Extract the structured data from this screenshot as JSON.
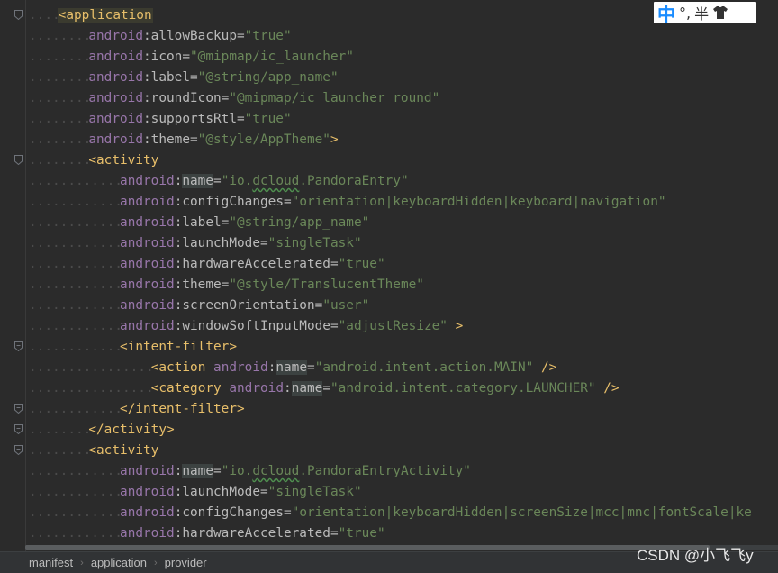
{
  "editor": {
    "language": "xml",
    "file": "manifest",
    "lines": [
      {
        "indent": 1,
        "tokens": [
          {
            "t": "hl-tag",
            "v": "<application"
          }
        ]
      },
      {
        "indent": 2,
        "tokens": [
          {
            "t": "ns",
            "v": "android"
          },
          {
            "t": "attr",
            "v": ":allowBackup="
          },
          {
            "t": "val",
            "v": "\"true\""
          }
        ]
      },
      {
        "indent": 2,
        "tokens": [
          {
            "t": "ns",
            "v": "android"
          },
          {
            "t": "attr",
            "v": ":icon="
          },
          {
            "t": "val",
            "v": "\"@mipmap/ic_launcher\""
          }
        ]
      },
      {
        "indent": 2,
        "tokens": [
          {
            "t": "ns",
            "v": "android"
          },
          {
            "t": "attr",
            "v": ":label="
          },
          {
            "t": "val",
            "v": "\"@string/app_name\""
          }
        ]
      },
      {
        "indent": 2,
        "tokens": [
          {
            "t": "ns",
            "v": "android"
          },
          {
            "t": "attr",
            "v": ":roundIcon="
          },
          {
            "t": "val",
            "v": "\"@mipmap/ic_launcher_round\""
          }
        ]
      },
      {
        "indent": 2,
        "tokens": [
          {
            "t": "ns",
            "v": "android"
          },
          {
            "t": "attr",
            "v": ":supportsRtl="
          },
          {
            "t": "val",
            "v": "\"true\""
          }
        ]
      },
      {
        "indent": 2,
        "tokens": [
          {
            "t": "ns",
            "v": "android"
          },
          {
            "t": "attr",
            "v": ":theme="
          },
          {
            "t": "val",
            "v": "\"@style/AppTheme\""
          },
          {
            "t": "tag",
            "v": ">"
          }
        ]
      },
      {
        "indent": 2,
        "tokens": [
          {
            "t": "tag",
            "v": "<activity"
          }
        ]
      },
      {
        "indent": 3,
        "tokens": [
          {
            "t": "ns",
            "v": "android"
          },
          {
            "t": "attr",
            "v": ":"
          },
          {
            "t": "attr hl-name",
            "v": "name"
          },
          {
            "t": "attr",
            "v": "="
          },
          {
            "t": "val",
            "v": "\"io."
          },
          {
            "t": "val wavy",
            "v": "dcloud"
          },
          {
            "t": "val",
            "v": ".PandoraEntry\""
          }
        ]
      },
      {
        "indent": 3,
        "tokens": [
          {
            "t": "ns",
            "v": "android"
          },
          {
            "t": "attr",
            "v": ":configChanges="
          },
          {
            "t": "val",
            "v": "\"orientation|keyboardHidden|keyboard|navigation\""
          }
        ]
      },
      {
        "indent": 3,
        "tokens": [
          {
            "t": "ns",
            "v": "android"
          },
          {
            "t": "attr",
            "v": ":label="
          },
          {
            "t": "val",
            "v": "\"@string/app_name\""
          }
        ]
      },
      {
        "indent": 3,
        "tokens": [
          {
            "t": "ns",
            "v": "android"
          },
          {
            "t": "attr",
            "v": ":launchMode="
          },
          {
            "t": "val",
            "v": "\"singleTask\""
          }
        ]
      },
      {
        "indent": 3,
        "tokens": [
          {
            "t": "ns",
            "v": "android"
          },
          {
            "t": "attr",
            "v": ":hardwareAccelerated="
          },
          {
            "t": "val",
            "v": "\"true\""
          }
        ]
      },
      {
        "indent": 3,
        "tokens": [
          {
            "t": "ns",
            "v": "android"
          },
          {
            "t": "attr",
            "v": ":theme="
          },
          {
            "t": "val",
            "v": "\"@style/TranslucentTheme\""
          }
        ]
      },
      {
        "indent": 3,
        "tokens": [
          {
            "t": "ns",
            "v": "android"
          },
          {
            "t": "attr",
            "v": ":screenOrientation="
          },
          {
            "t": "val",
            "v": "\"user\""
          }
        ]
      },
      {
        "indent": 3,
        "tokens": [
          {
            "t": "ns",
            "v": "android"
          },
          {
            "t": "attr",
            "v": ":windowSoftInputMode="
          },
          {
            "t": "val",
            "v": "\"adjustResize\""
          },
          {
            "t": "tag",
            "v": " >"
          }
        ]
      },
      {
        "indent": 3,
        "tokens": [
          {
            "t": "tag",
            "v": "<intent-filter>"
          }
        ]
      },
      {
        "indent": 4,
        "tokens": [
          {
            "t": "tag",
            "v": "<action "
          },
          {
            "t": "ns",
            "v": "android"
          },
          {
            "t": "attr",
            "v": ":"
          },
          {
            "t": "attr hl-name",
            "v": "name"
          },
          {
            "t": "attr",
            "v": "="
          },
          {
            "t": "val",
            "v": "\"android.intent.action.MAIN\""
          },
          {
            "t": "tag",
            "v": " />"
          }
        ]
      },
      {
        "indent": 4,
        "tokens": [
          {
            "t": "tag",
            "v": "<category "
          },
          {
            "t": "ns",
            "v": "android"
          },
          {
            "t": "attr",
            "v": ":"
          },
          {
            "t": "attr hl-name",
            "v": "name"
          },
          {
            "t": "attr",
            "v": "="
          },
          {
            "t": "val",
            "v": "\"android.intent.category.LAUNCHER\""
          },
          {
            "t": "tag",
            "v": " />"
          }
        ]
      },
      {
        "indent": 3,
        "tokens": [
          {
            "t": "tag",
            "v": "</intent-filter>"
          }
        ]
      },
      {
        "indent": 2,
        "tokens": [
          {
            "t": "tag",
            "v": "</activity>"
          }
        ]
      },
      {
        "indent": 2,
        "tokens": [
          {
            "t": "tag",
            "v": "<activity"
          }
        ]
      },
      {
        "indent": 3,
        "tokens": [
          {
            "t": "ns",
            "v": "android"
          },
          {
            "t": "attr",
            "v": ":"
          },
          {
            "t": "attr hl-name",
            "v": "name"
          },
          {
            "t": "attr",
            "v": "="
          },
          {
            "t": "val",
            "v": "\"io."
          },
          {
            "t": "val wavy",
            "v": "dcloud"
          },
          {
            "t": "val",
            "v": ".PandoraEntryActivity\""
          }
        ]
      },
      {
        "indent": 3,
        "tokens": [
          {
            "t": "ns",
            "v": "android"
          },
          {
            "t": "attr",
            "v": ":launchMode="
          },
          {
            "t": "val",
            "v": "\"singleTask\""
          }
        ]
      },
      {
        "indent": 3,
        "tokens": [
          {
            "t": "ns",
            "v": "android"
          },
          {
            "t": "attr",
            "v": ":configChanges="
          },
          {
            "t": "val",
            "v": "\"orientation|keyboardHidden|screenSize|mcc|mnc|fontScale|ke"
          }
        ]
      },
      {
        "indent": 3,
        "tokens": [
          {
            "t": "ns",
            "v": "android"
          },
          {
            "t": "attr",
            "v": ":hardwareAccelerated="
          },
          {
            "t": "val",
            "v": "\"true\""
          }
        ]
      }
    ],
    "fold_markers": [
      0,
      7,
      16,
      19,
      20,
      21
    ]
  },
  "ime": {
    "mode_label": "中",
    "punct_label": "°,",
    "width_label": "半",
    "skin_icon": "shirt-icon"
  },
  "breadcrumb": {
    "items": [
      "manifest",
      "application",
      "provider"
    ],
    "separator": "›"
  },
  "watermark": "CSDN @小飞飞y",
  "colors": {
    "background": "#2b2b2b",
    "tag": "#e8bf6a",
    "namespace": "#9876aa",
    "attribute": "#bababa",
    "value": "#6a8759"
  }
}
